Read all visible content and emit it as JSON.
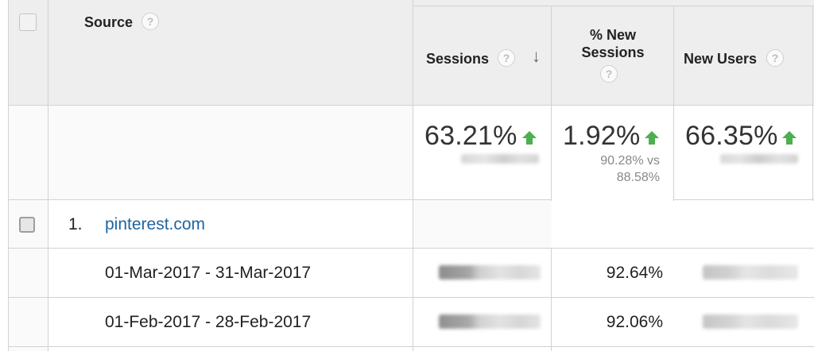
{
  "columns": {
    "source": "Source",
    "sessions": "Sessions",
    "new_sessions_line1": "% New",
    "new_sessions_line2": "Sessions",
    "new_users": "New Users",
    "help_glyph": "?",
    "sort_glyph": "↓"
  },
  "totals": {
    "sessions_change": "63.21%",
    "new_sessions_change": "1.92%",
    "new_sessions_cmp_line1": "90.28% vs",
    "new_sessions_cmp_line2": "88.58%",
    "new_users_change": "66.35%"
  },
  "colors": {
    "up_arrow": "#4caf50",
    "link": "#1e64a0",
    "header_bg": "#eeeeee",
    "border": "#d2d2d2"
  },
  "rows": [
    {
      "index": "1.",
      "source": "pinterest.com",
      "periods": [
        {
          "label": "01-Mar-2017 - 31-Mar-2017",
          "new_sessions": "92.64%"
        },
        {
          "label": "01-Feb-2017 - 28-Feb-2017",
          "new_sessions": "92.06%"
        }
      ]
    }
  ]
}
